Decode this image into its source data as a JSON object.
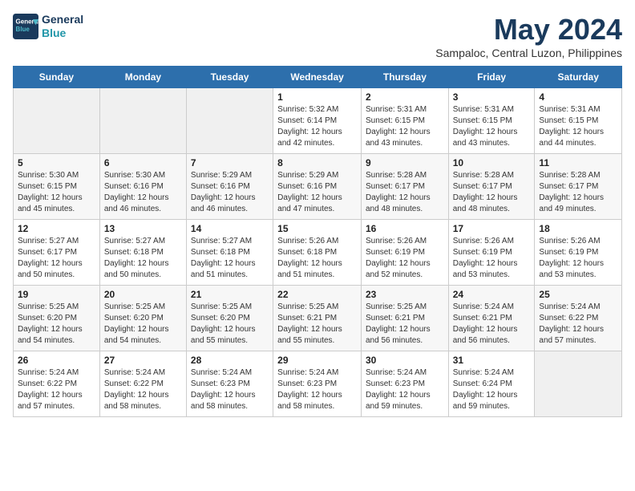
{
  "header": {
    "logo_line1": "General",
    "logo_line2": "Blue",
    "month": "May 2024",
    "location": "Sampaloc, Central Luzon, Philippines"
  },
  "weekdays": [
    "Sunday",
    "Monday",
    "Tuesday",
    "Wednesday",
    "Thursday",
    "Friday",
    "Saturday"
  ],
  "weeks": [
    [
      {
        "day": "",
        "info": ""
      },
      {
        "day": "",
        "info": ""
      },
      {
        "day": "",
        "info": ""
      },
      {
        "day": "1",
        "info": "Sunrise: 5:32 AM\nSunset: 6:14 PM\nDaylight: 12 hours\nand 42 minutes."
      },
      {
        "day": "2",
        "info": "Sunrise: 5:31 AM\nSunset: 6:15 PM\nDaylight: 12 hours\nand 43 minutes."
      },
      {
        "day": "3",
        "info": "Sunrise: 5:31 AM\nSunset: 6:15 PM\nDaylight: 12 hours\nand 43 minutes."
      },
      {
        "day": "4",
        "info": "Sunrise: 5:31 AM\nSunset: 6:15 PM\nDaylight: 12 hours\nand 44 minutes."
      }
    ],
    [
      {
        "day": "5",
        "info": "Sunrise: 5:30 AM\nSunset: 6:15 PM\nDaylight: 12 hours\nand 45 minutes."
      },
      {
        "day": "6",
        "info": "Sunrise: 5:30 AM\nSunset: 6:16 PM\nDaylight: 12 hours\nand 46 minutes."
      },
      {
        "day": "7",
        "info": "Sunrise: 5:29 AM\nSunset: 6:16 PM\nDaylight: 12 hours\nand 46 minutes."
      },
      {
        "day": "8",
        "info": "Sunrise: 5:29 AM\nSunset: 6:16 PM\nDaylight: 12 hours\nand 47 minutes."
      },
      {
        "day": "9",
        "info": "Sunrise: 5:28 AM\nSunset: 6:17 PM\nDaylight: 12 hours\nand 48 minutes."
      },
      {
        "day": "10",
        "info": "Sunrise: 5:28 AM\nSunset: 6:17 PM\nDaylight: 12 hours\nand 48 minutes."
      },
      {
        "day": "11",
        "info": "Sunrise: 5:28 AM\nSunset: 6:17 PM\nDaylight: 12 hours\nand 49 minutes."
      }
    ],
    [
      {
        "day": "12",
        "info": "Sunrise: 5:27 AM\nSunset: 6:17 PM\nDaylight: 12 hours\nand 50 minutes."
      },
      {
        "day": "13",
        "info": "Sunrise: 5:27 AM\nSunset: 6:18 PM\nDaylight: 12 hours\nand 50 minutes."
      },
      {
        "day": "14",
        "info": "Sunrise: 5:27 AM\nSunset: 6:18 PM\nDaylight: 12 hours\nand 51 minutes."
      },
      {
        "day": "15",
        "info": "Sunrise: 5:26 AM\nSunset: 6:18 PM\nDaylight: 12 hours\nand 51 minutes."
      },
      {
        "day": "16",
        "info": "Sunrise: 5:26 AM\nSunset: 6:19 PM\nDaylight: 12 hours\nand 52 minutes."
      },
      {
        "day": "17",
        "info": "Sunrise: 5:26 AM\nSunset: 6:19 PM\nDaylight: 12 hours\nand 53 minutes."
      },
      {
        "day": "18",
        "info": "Sunrise: 5:26 AM\nSunset: 6:19 PM\nDaylight: 12 hours\nand 53 minutes."
      }
    ],
    [
      {
        "day": "19",
        "info": "Sunrise: 5:25 AM\nSunset: 6:20 PM\nDaylight: 12 hours\nand 54 minutes."
      },
      {
        "day": "20",
        "info": "Sunrise: 5:25 AM\nSunset: 6:20 PM\nDaylight: 12 hours\nand 54 minutes."
      },
      {
        "day": "21",
        "info": "Sunrise: 5:25 AM\nSunset: 6:20 PM\nDaylight: 12 hours\nand 55 minutes."
      },
      {
        "day": "22",
        "info": "Sunrise: 5:25 AM\nSunset: 6:21 PM\nDaylight: 12 hours\nand 55 minutes."
      },
      {
        "day": "23",
        "info": "Sunrise: 5:25 AM\nSunset: 6:21 PM\nDaylight: 12 hours\nand 56 minutes."
      },
      {
        "day": "24",
        "info": "Sunrise: 5:24 AM\nSunset: 6:21 PM\nDaylight: 12 hours\nand 56 minutes."
      },
      {
        "day": "25",
        "info": "Sunrise: 5:24 AM\nSunset: 6:22 PM\nDaylight: 12 hours\nand 57 minutes."
      }
    ],
    [
      {
        "day": "26",
        "info": "Sunrise: 5:24 AM\nSunset: 6:22 PM\nDaylight: 12 hours\nand 57 minutes."
      },
      {
        "day": "27",
        "info": "Sunrise: 5:24 AM\nSunset: 6:22 PM\nDaylight: 12 hours\nand 58 minutes."
      },
      {
        "day": "28",
        "info": "Sunrise: 5:24 AM\nSunset: 6:23 PM\nDaylight: 12 hours\nand 58 minutes."
      },
      {
        "day": "29",
        "info": "Sunrise: 5:24 AM\nSunset: 6:23 PM\nDaylight: 12 hours\nand 58 minutes."
      },
      {
        "day": "30",
        "info": "Sunrise: 5:24 AM\nSunset: 6:23 PM\nDaylight: 12 hours\nand 59 minutes."
      },
      {
        "day": "31",
        "info": "Sunrise: 5:24 AM\nSunset: 6:24 PM\nDaylight: 12 hours\nand 59 minutes."
      },
      {
        "day": "",
        "info": ""
      }
    ]
  ]
}
